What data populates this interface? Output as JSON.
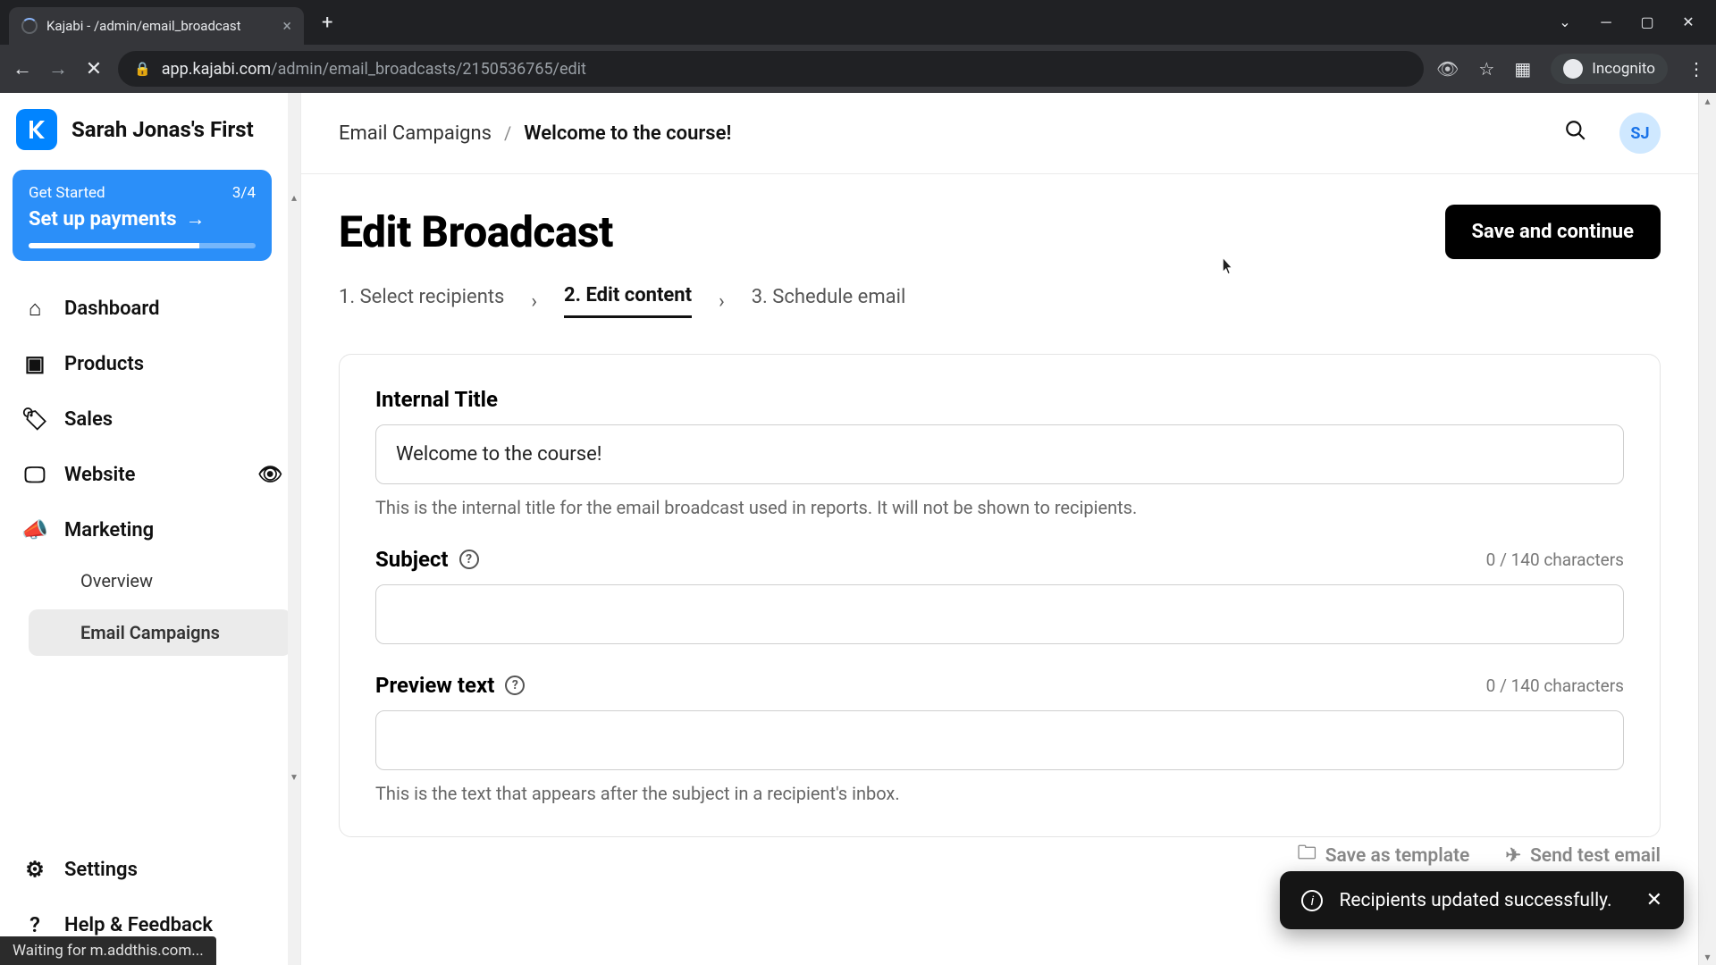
{
  "browser": {
    "tab_title": "Kajabi - /admin/email_broadcast",
    "url_domain": "app.kajabi.com",
    "url_path": "/admin/email_broadcasts/2150536765/edit",
    "incognito_label": "Incognito",
    "status_text": "Waiting for m.addthis.com..."
  },
  "sidebar": {
    "brand": "Sarah Jonas's First",
    "onboard": {
      "label": "Get Started",
      "progress": "3/4",
      "cta": "Set up payments"
    },
    "items": [
      {
        "label": "Dashboard"
      },
      {
        "label": "Products"
      },
      {
        "label": "Sales"
      },
      {
        "label": "Website"
      },
      {
        "label": "Marketing"
      }
    ],
    "marketing_sub": [
      {
        "label": "Overview"
      },
      {
        "label": "Email Campaigns"
      }
    ],
    "bottom": [
      {
        "label": "Settings"
      },
      {
        "label": "Help & Feedback"
      }
    ]
  },
  "header": {
    "breadcrumb_root": "Email Campaigns",
    "breadcrumb_current": "Welcome to the course!",
    "avatar_initials": "SJ"
  },
  "page": {
    "title": "Edit Broadcast",
    "save_label": "Save and continue",
    "steps": {
      "s1": "1. Select recipients",
      "s2": "2. Edit content",
      "s3": "3. Schedule email"
    },
    "internal_title": {
      "label": "Internal Title",
      "value": "Welcome to the course!",
      "hint": "This is the internal title for the email broadcast used in reports. It will not be shown to recipients."
    },
    "subject": {
      "label": "Subject",
      "value": "",
      "counter": "0 / 140 characters"
    },
    "preview": {
      "label": "Preview text",
      "value": "",
      "counter": "0 / 140 characters",
      "hint": "This is the text that appears after the subject in a recipient's inbox."
    },
    "footer_actions": {
      "save_template": "Save as template",
      "send_test": "Send test email"
    }
  },
  "toast": {
    "message": "Recipients updated successfully."
  }
}
